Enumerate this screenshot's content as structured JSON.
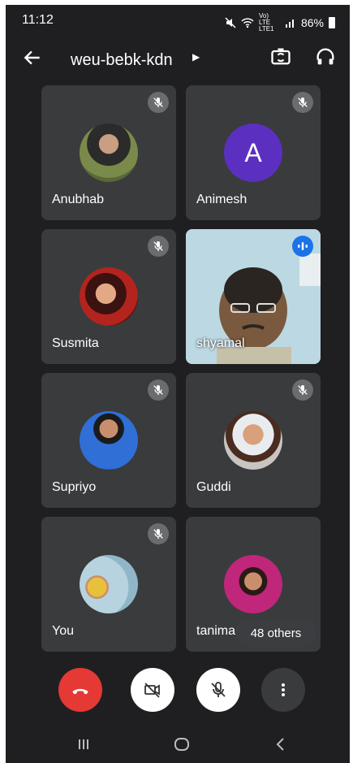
{
  "status": {
    "time": "11:12",
    "battery": "86%",
    "network": "Vo) LTE LTE1"
  },
  "header": {
    "meeting_code": "weu-bebk-kdn"
  },
  "participants": [
    {
      "name": "Anubhab",
      "muted": true
    },
    {
      "name": "Animesh",
      "muted": true,
      "initial": "A"
    },
    {
      "name": "Susmita",
      "muted": true
    },
    {
      "name": "shyamal",
      "muted": false,
      "video_on": true
    },
    {
      "name": "Supriyo",
      "muted": true
    },
    {
      "name": "Guddi",
      "muted": true
    },
    {
      "name": "You",
      "muted": true
    },
    {
      "name": "tanima",
      "muted": false
    }
  ],
  "others_label": "48 others",
  "colors": {
    "end_call": "#e53935",
    "letter_avatar": "#5b2fbf",
    "speaking": "#1a73e8"
  }
}
